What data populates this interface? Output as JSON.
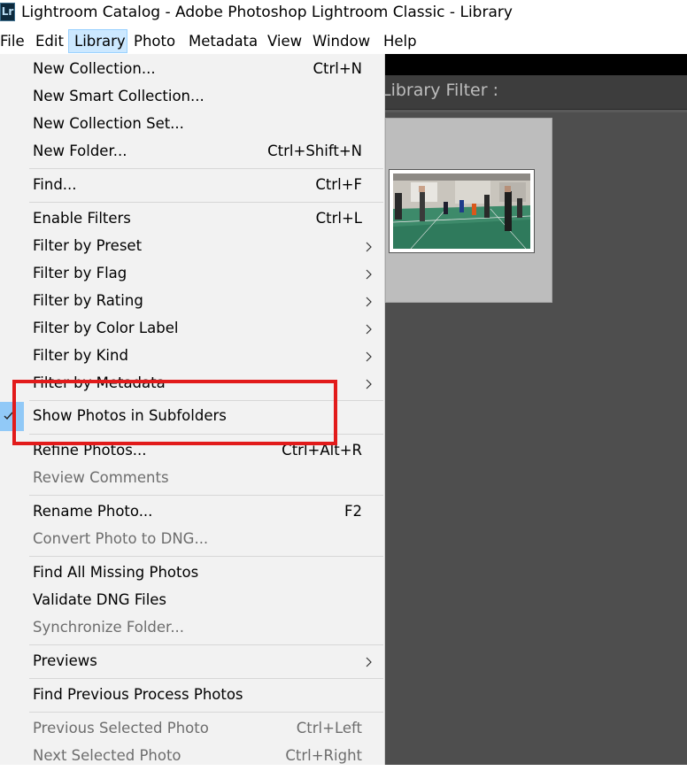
{
  "window": {
    "app_icon_text": "Lr",
    "title": "Lightroom Catalog - Adobe Photoshop Lightroom Classic - Library"
  },
  "menubar": {
    "items": [
      "File",
      "Edit",
      "Library",
      "Photo",
      "Metadata",
      "View",
      "Window",
      "Help"
    ],
    "active": "Library"
  },
  "library_menu": {
    "items": [
      {
        "label": "New Collection...",
        "shortcut": "Ctrl+N"
      },
      {
        "label": "New Smart Collection...",
        "shortcut": ""
      },
      {
        "label": "New Collection Set...",
        "shortcut": ""
      },
      {
        "label": "New Folder...",
        "shortcut": "Ctrl+Shift+N"
      },
      {
        "label": "Find...",
        "shortcut": "Ctrl+F"
      },
      {
        "label": "Enable Filters",
        "shortcut": "Ctrl+L"
      },
      {
        "label": "Filter by Preset",
        "shortcut": "",
        "submenu": true
      },
      {
        "label": "Filter by Flag",
        "shortcut": "",
        "submenu": true
      },
      {
        "label": "Filter by Rating",
        "shortcut": "",
        "submenu": true
      },
      {
        "label": "Filter by Color Label",
        "shortcut": "",
        "submenu": true
      },
      {
        "label": "Filter by Kind",
        "shortcut": "",
        "submenu": true
      },
      {
        "label": "Filter by Metadata",
        "shortcut": "",
        "submenu": true
      },
      {
        "label": "Show Photos in Subfolders",
        "shortcut": "",
        "checked": true
      },
      {
        "label": "Refine Photos...",
        "shortcut": "Ctrl+Alt+R"
      },
      {
        "label": "Review Comments",
        "shortcut": "",
        "disabled": true
      },
      {
        "label": "Rename Photo...",
        "shortcut": "F2"
      },
      {
        "label": "Convert Photo to DNG...",
        "shortcut": "",
        "disabled": true
      },
      {
        "label": "Find All Missing Photos",
        "shortcut": ""
      },
      {
        "label": "Validate DNG Files",
        "shortcut": ""
      },
      {
        "label": "Synchronize Folder...",
        "shortcut": "",
        "disabled": true
      },
      {
        "label": "Previews",
        "shortcut": "",
        "submenu": true
      },
      {
        "label": "Find Previous Process Photos",
        "shortcut": ""
      },
      {
        "label": "Previous Selected Photo",
        "shortcut": "Ctrl+Left",
        "disabled": true
      },
      {
        "label": "Next Selected Photo",
        "shortcut": "Ctrl+Right",
        "disabled": true
      }
    ]
  },
  "library_filter": {
    "label": "Library Filter :"
  },
  "colors": {
    "highlight_box": "#e21b1b",
    "menu_bg": "#f2f2f2",
    "active_menu_bg": "#cce8ff",
    "check_bg": "#91c9f7",
    "app_bg": "#4e4e4e"
  }
}
